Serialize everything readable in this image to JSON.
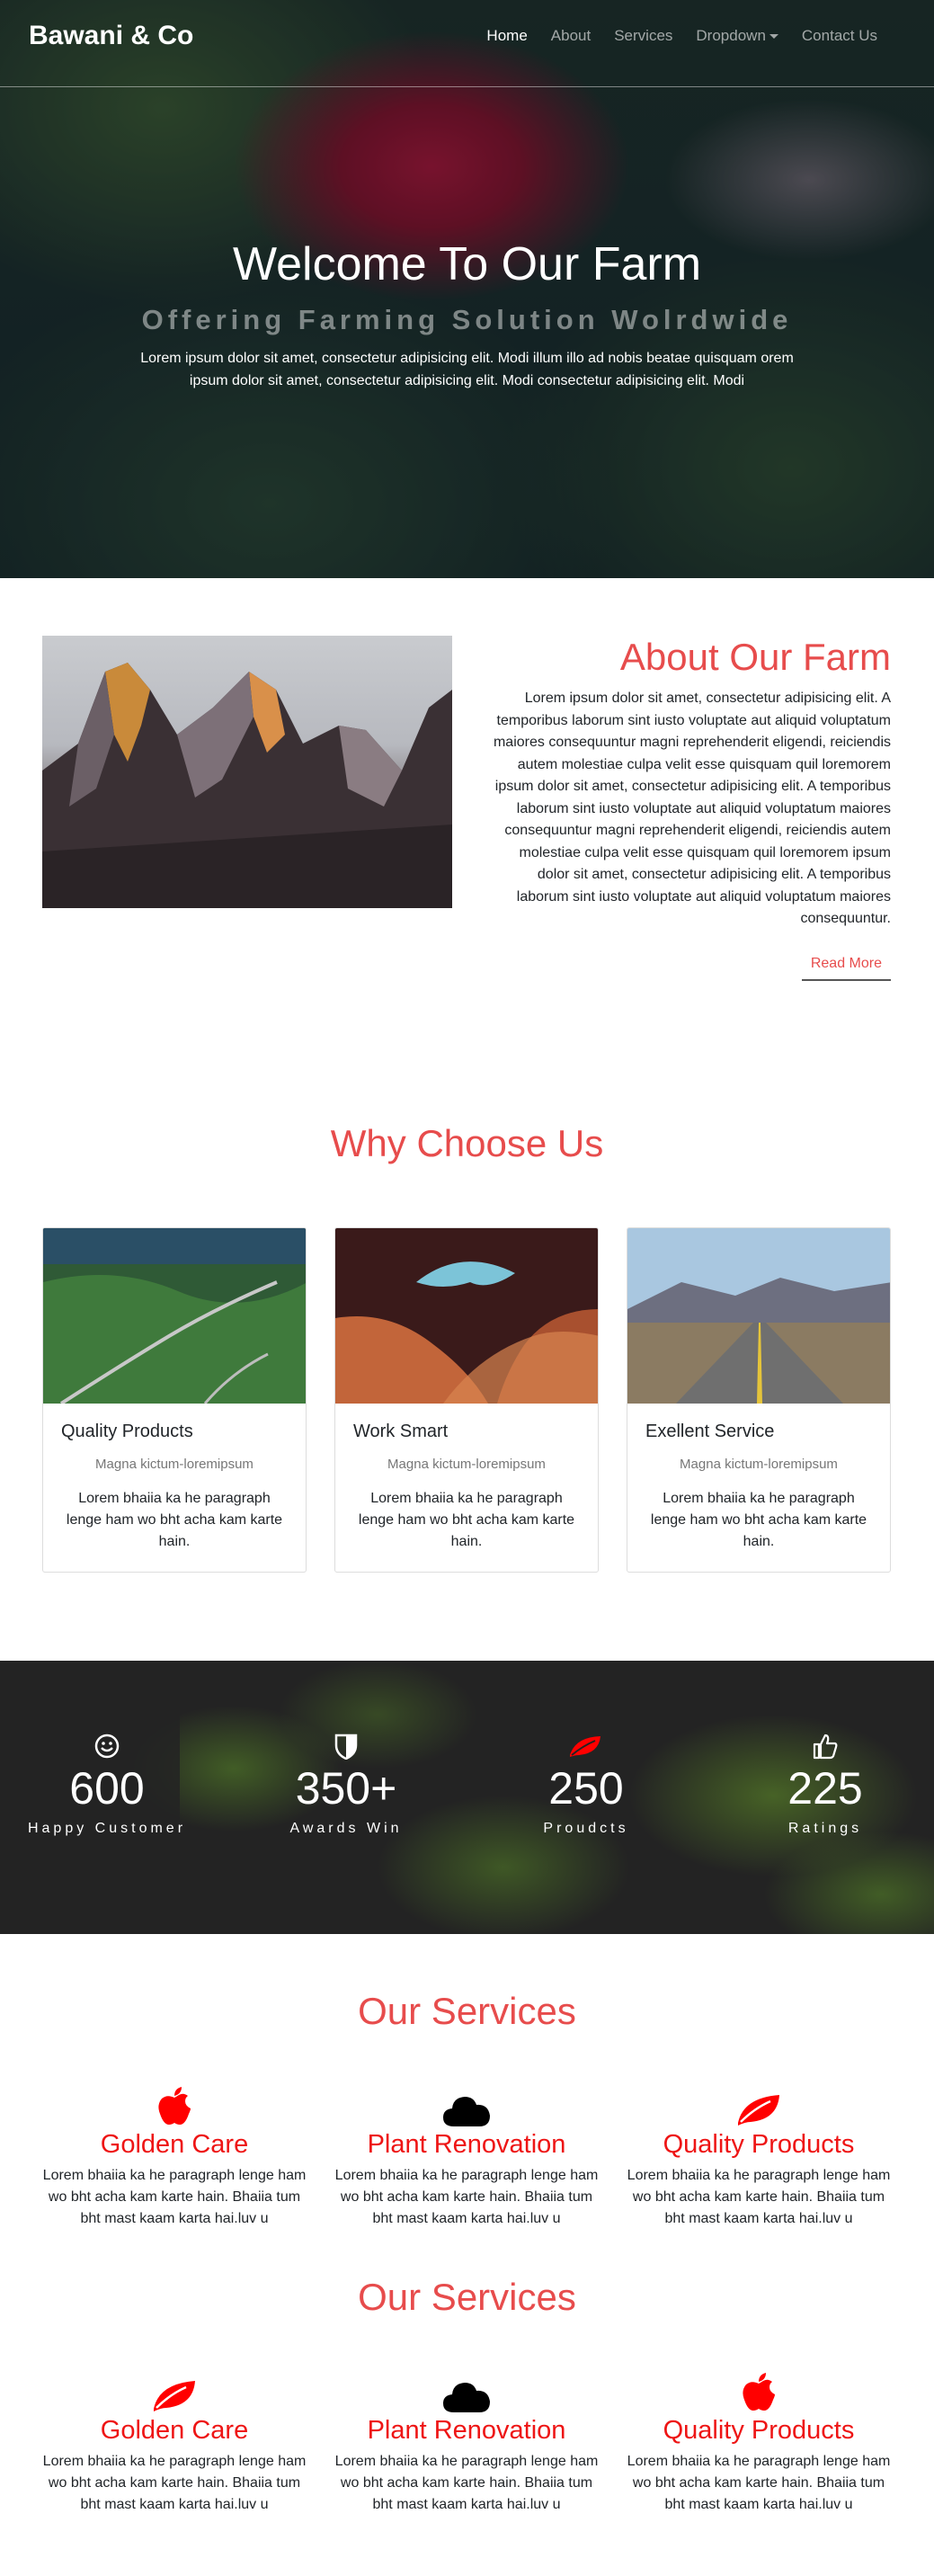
{
  "nav": {
    "brand": "Bawani & Co",
    "links": [
      "Home",
      "About",
      "Services",
      "Dropdown",
      "Contact Us"
    ]
  },
  "hero": {
    "title": "Welcome To Our Farm",
    "subtitle": "Offering Farming Solution Wolrdwide",
    "text": "Lorem ipsum dolor sit amet, consectetur adipisicing elit. Modi illum illo ad nobis beatae quisquam orem ipsum dolor sit amet, consectetur adipisicing elit. Modi consectetur adipisicing elit. Modi"
  },
  "about": {
    "title": "About Our Farm",
    "text": "Lorem ipsum dolor sit amet, consectetur adipisicing elit. A temporibus laborum sint iusto voluptate aut aliquid voluptatum maiores consequuntur magni reprehenderit eligendi, reiciendis autem molestiae culpa velit esse quisquam quil loremorem ipsum dolor sit amet, consectetur adipisicing elit. A temporibus laborum sint iusto voluptate aut aliquid voluptatum maiores consequuntur magni reprehenderit eligendi, reiciendis autem molestiae culpa velit esse quisquam quil loremorem ipsum dolor sit amet, consectetur adipisicing elit. A temporibus laborum sint iusto voluptate aut aliquid voluptatum maiores consequuntur.",
    "button": "Read More"
  },
  "why": {
    "title": "Why Choose Us",
    "cards": [
      {
        "title": "Quality Products",
        "subtitle": "Magna kictum-loremipsum",
        "text": "Lorem bhaiia ka he paragraph lenge ham wo bht acha kam karte hain."
      },
      {
        "title": "Work Smart",
        "subtitle": "Magna kictum-loremipsum",
        "text": "Lorem bhaiia ka he paragraph lenge ham wo bht acha kam karte hain."
      },
      {
        "title": "Exellent Service",
        "subtitle": "Magna kictum-loremipsum",
        "text": "Lorem bhaiia ka he paragraph lenge ham wo bht acha kam karte hain."
      }
    ]
  },
  "stats": [
    {
      "icon": "smile-icon",
      "value": "600",
      "label": "Happy Customer",
      "color": "#ffffff"
    },
    {
      "icon": "shield-icon",
      "value": "350+",
      "label": "Awards Win",
      "color": "#ffffff"
    },
    {
      "icon": "leaf-icon",
      "value": "250",
      "label": "Proudcts",
      "color": "#ff0000"
    },
    {
      "icon": "thumbs-up-icon",
      "value": "225",
      "label": "Ratings",
      "color": "#ffffff"
    }
  ],
  "services": [
    {
      "title": "Our Services",
      "items": [
        {
          "icon": "apple-icon",
          "title": "Golden Care",
          "text": "Lorem bhaiia ka he paragraph lenge ham wo bht acha kam karte hain. Bhaiia tum bht mast kaam karta hai.luv u"
        },
        {
          "icon": "cloud-icon",
          "title": "Plant Renovation",
          "text": "Lorem bhaiia ka he paragraph lenge ham wo bht acha kam karte hain. Bhaiia tum bht mast kaam karta hai.luv u"
        },
        {
          "icon": "leaf-icon",
          "title": "Quality Products",
          "text": "Lorem bhaiia ka he paragraph lenge ham wo bht acha kam karte hain. Bhaiia tum bht mast kaam karta hai.luv u"
        }
      ]
    },
    {
      "title": "Our Services",
      "items": [
        {
          "icon": "leaf-icon",
          "title": "Golden Care",
          "text": "Lorem bhaiia ka he paragraph lenge ham wo bht acha kam karte hain. Bhaiia tum bht mast kaam karta hai.luv u"
        },
        {
          "icon": "cloud-icon",
          "title": "Plant Renovation",
          "text": "Lorem bhaiia ka he paragraph lenge ham wo bht acha kam karte hain. Bhaiia tum bht mast kaam karta hai.luv u"
        },
        {
          "icon": "apple-icon",
          "title": "Quality Products",
          "text": "Lorem bhaiia ka he paragraph lenge ham wo bht acha kam karte hain. Bhaiia tum bht mast kaam karta hai.luv u"
        }
      ]
    }
  ],
  "colors": {
    "accent": "#e74c4c",
    "service_title": "#ee1515",
    "icon_red": "#ff0000"
  }
}
